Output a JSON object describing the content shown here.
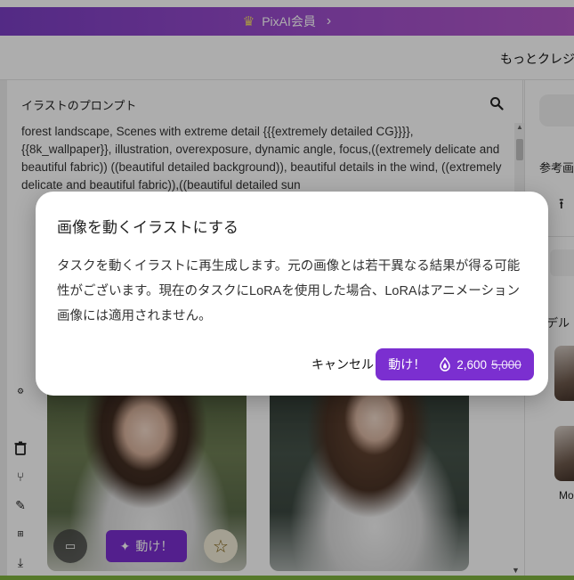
{
  "banner": {
    "label": "PixAI会員",
    "crown_icon": "crown-icon",
    "chevron_icon": "chevron-right-icon",
    "color_start": "#7b3fc4",
    "color_end": "#b45ac9"
  },
  "header": {
    "credits_link": "もっとクレジット"
  },
  "prompt": {
    "title": "イラストのプロンプト",
    "text": "forest landscape, Scenes with extreme detail {{{extremely detailed CG}}}}, {{8k_wallpaper}}, illustration, overexposure, dynamic angle, focus,((extremely delicate and beautiful fabric)) ((beautiful detailed background)), beautiful details in the wind, ((extremely delicate and beautiful fabric)),((beautiful detailed sun"
  },
  "right_panel": {
    "reference_label": "参考画",
    "model_label": "デル",
    "model_name": "Mo"
  },
  "gallery": {
    "animate_label": "動け！"
  },
  "dialog": {
    "title": "画像を動くイラストにする",
    "body": "タスクを動くイラストに再生成します。元の画像とは若干異なる結果が得る可能性がございます。現在のタスクにLoRAを使用した場合、LoRAはアニメーション画像には適用されません。",
    "cancel_label": "キャンセル",
    "confirm_label": "動け！",
    "cost_current": "2,600",
    "cost_original": "5,000",
    "accent_color": "#7b2fd0"
  }
}
